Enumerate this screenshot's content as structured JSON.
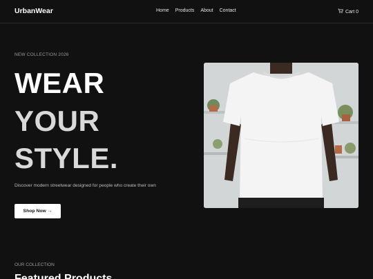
{
  "nav": {
    "brand": "UrbanWear",
    "links": [
      "Home",
      "Products",
      "About",
      "Contact"
    ],
    "cart_label": "Cart 0"
  },
  "hero": {
    "eyebrow": "NEW COLLECTION 2026",
    "line1": "WEAR",
    "line2": "YOUR",
    "line3": "STYLE.",
    "subtitle": "Discover modern streetwear designed for people who create their own",
    "cta_label": "Shop Now →"
  },
  "collection": {
    "eyebrow": "OUR COLLECTION",
    "title": "Featured Products"
  },
  "colors": {
    "background": "#111112",
    "text": "#ffffff",
    "muted": "#9a9a9a",
    "button_bg": "#ffffff"
  },
  "icons": {
    "cart": "shopping-cart-icon",
    "arrow": "arrow-right-icon"
  }
}
